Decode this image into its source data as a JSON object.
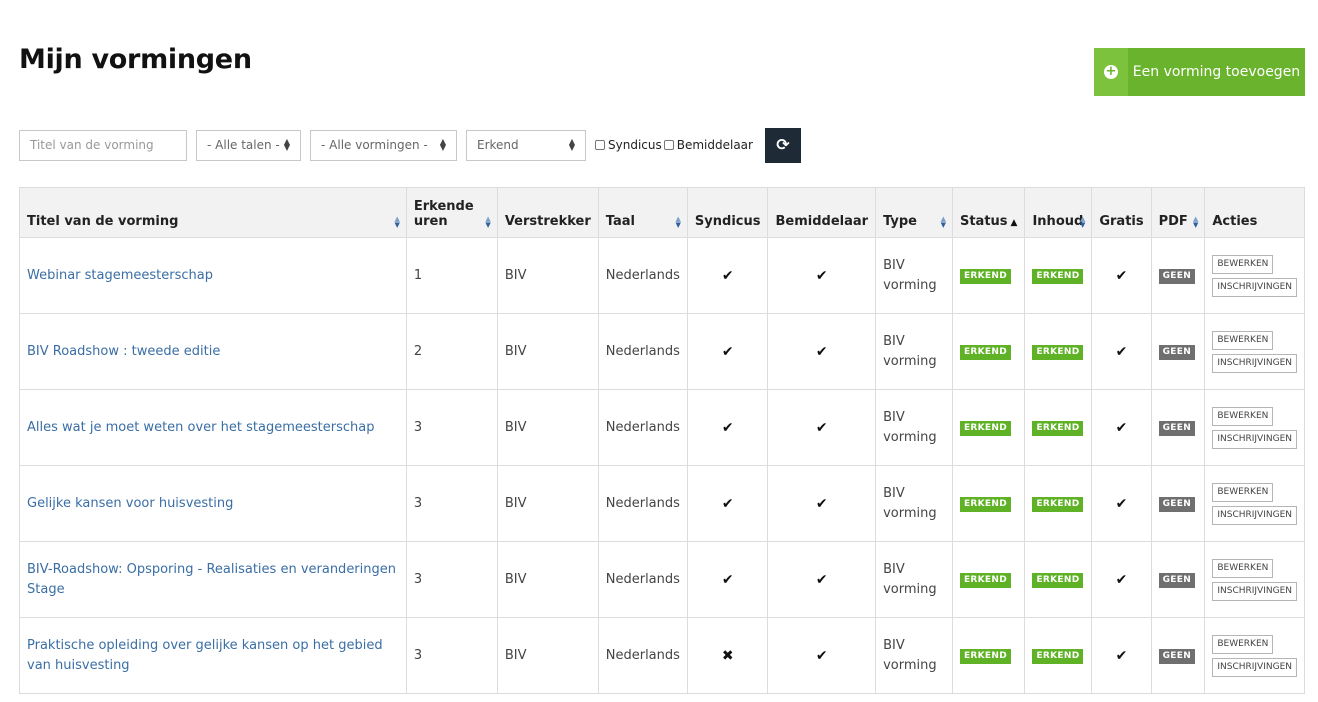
{
  "page": {
    "title": "Mijn vormingen"
  },
  "add_button": {
    "label": "Een vorming toevoegen",
    "icon": "plus-circle-icon"
  },
  "filters": {
    "title_placeholder": "Titel van de vorming",
    "language_select": "- Alle talen -",
    "training_select": "- Alle vormingen -",
    "status_select": "Erkend",
    "syndicus_label": "Syndicus",
    "bemiddelaar_label": "Bemiddelaar",
    "refresh_icon": "refresh-icon"
  },
  "table": {
    "headers": {
      "title": "Titel van de vorming",
      "hours_line1": "Erkende",
      "hours_line2": "uren",
      "provider": "Verstrekker",
      "language": "Taal",
      "syndicus": "Syndicus",
      "bemiddelaar": "Bemiddelaar",
      "type": "Type",
      "status": "Status",
      "content": "Inhoud",
      "free": "Gratis",
      "pdf": "PDF",
      "actions": "Acties"
    },
    "rows": [
      {
        "title": "Webinar stagemeesterschap",
        "hours": "1",
        "provider": "BIV",
        "language": "Nederlands",
        "syndicus": "✔",
        "bemiddelaar": "✔",
        "type": "BIV vorming",
        "status": "ERKEND",
        "content": "ERKEND",
        "free": "✔",
        "pdf": "GEEN",
        "edit": "BEWERKEN",
        "registrations": "INSCHRIJVINGEN"
      },
      {
        "title": "BIV Roadshow : tweede editie",
        "hours": "2",
        "provider": "BIV",
        "language": "Nederlands",
        "syndicus": "✔",
        "bemiddelaar": "✔",
        "type": "BIV vorming",
        "status": "ERKEND",
        "content": "ERKEND",
        "free": "✔",
        "pdf": "GEEN",
        "edit": "BEWERKEN",
        "registrations": "INSCHRIJVINGEN"
      },
      {
        "title": "Alles wat je moet weten over het stagemeesterschap",
        "hours": "3",
        "provider": "BIV",
        "language": "Nederlands",
        "syndicus": "✔",
        "bemiddelaar": "✔",
        "type": "BIV vorming",
        "status": "ERKEND",
        "content": "ERKEND",
        "free": "✔",
        "pdf": "GEEN",
        "edit": "BEWERKEN",
        "registrations": "INSCHRIJVINGEN"
      },
      {
        "title": "Gelijke kansen voor huisvesting",
        "hours": "3",
        "provider": "BIV",
        "language": "Nederlands",
        "syndicus": "✔",
        "bemiddelaar": "✔",
        "type": "BIV vorming",
        "status": "ERKEND",
        "content": "ERKEND",
        "free": "✔",
        "pdf": "GEEN",
        "edit": "BEWERKEN",
        "registrations": "INSCHRIJVINGEN"
      },
      {
        "title": "BIV-Roadshow: Opsporing - Realisaties en veranderingen Stage",
        "hours": "3",
        "provider": "BIV",
        "language": "Nederlands",
        "syndicus": "✔",
        "bemiddelaar": "✔",
        "type": "BIV vorming",
        "status": "ERKEND",
        "content": "ERKEND",
        "free": "✔",
        "pdf": "GEEN",
        "edit": "BEWERKEN",
        "registrations": "INSCHRIJVINGEN"
      },
      {
        "title": "Praktische opleiding over gelijke kansen op het gebied van huisvesting",
        "hours": "3",
        "provider": "BIV",
        "language": "Nederlands",
        "syndicus": "✖",
        "bemiddelaar": "✔",
        "type": "BIV vorming",
        "status": "ERKEND",
        "content": "ERKEND",
        "free": "✔",
        "pdf": "GEEN",
        "edit": "BEWERKEN",
        "registrations": "INSCHRIJVINGEN"
      }
    ]
  },
  "colors": {
    "accent_green": "#6ab42d",
    "badge_green": "#5fb225",
    "badge_grey": "#6f6f6f",
    "dark_button": "#1e2a35",
    "link": "#3a6ea5"
  }
}
